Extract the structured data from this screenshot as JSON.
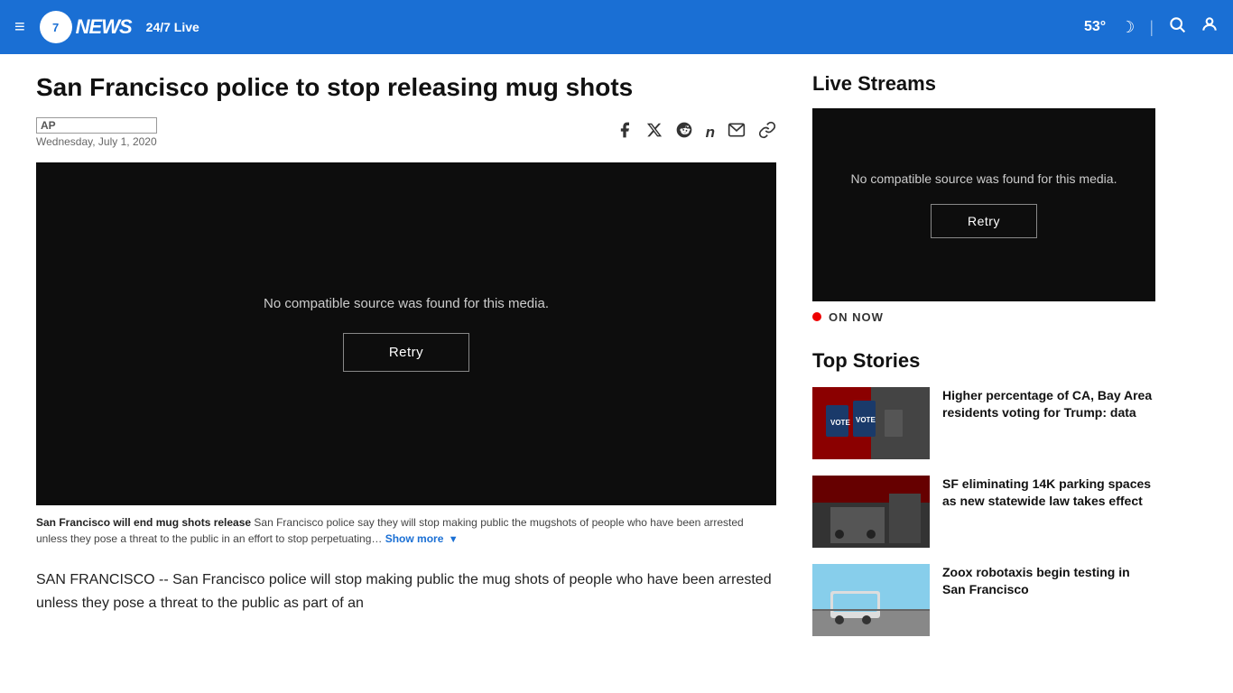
{
  "header": {
    "logo_number": "7",
    "logo_suffix": "NEWS",
    "live_label": "24/7 Live",
    "temperature": "53°",
    "hamburger_label": "≡",
    "search_symbol": "🔍",
    "user_symbol": "👤"
  },
  "article": {
    "title": "San Francisco police to stop releasing mug shots",
    "source": "AP",
    "date": "Wednesday, July 1, 2020",
    "video_error": "No compatible source was found for this media.",
    "retry_label": "Retry",
    "caption_bold": "San Francisco will end mug shots release",
    "caption_text": "  San Francisco police say they will stop making public the mugshots of people who have been arrested unless they pose a threat to the public in an effort to stop perpetuating…",
    "show_more": "Show more",
    "body_text": "SAN FRANCISCO -- San Francisco police will stop making public the mug shots of people who have been arrested unless they pose a threat to the public as part of an"
  },
  "share_icons": [
    {
      "name": "facebook-icon",
      "symbol": "f"
    },
    {
      "name": "twitter-x-icon",
      "symbol": "✕"
    },
    {
      "name": "reddit-icon",
      "symbol": "◉"
    },
    {
      "name": "newsbreak-icon",
      "symbol": "𝐧"
    },
    {
      "name": "email-icon",
      "symbol": "✉"
    },
    {
      "name": "link-icon",
      "symbol": "🔗"
    }
  ],
  "sidebar": {
    "live_streams_title": "Live Streams",
    "video_error": "No compatible source was found for this media.",
    "retry_label": "Retry",
    "on_now_label": "ON NOW",
    "top_stories_title": "Top Stories",
    "stories": [
      {
        "headline": "Higher percentage of CA, Bay Area residents voting for Trump: data",
        "thumb_type": "votes"
      },
      {
        "headline": "SF eliminating 14K parking spaces as new statewide law takes effect",
        "thumb_type": "parking"
      },
      {
        "headline": "Zoox robotaxis begin testing in San Francisco",
        "thumb_type": "taxi"
      }
    ]
  }
}
